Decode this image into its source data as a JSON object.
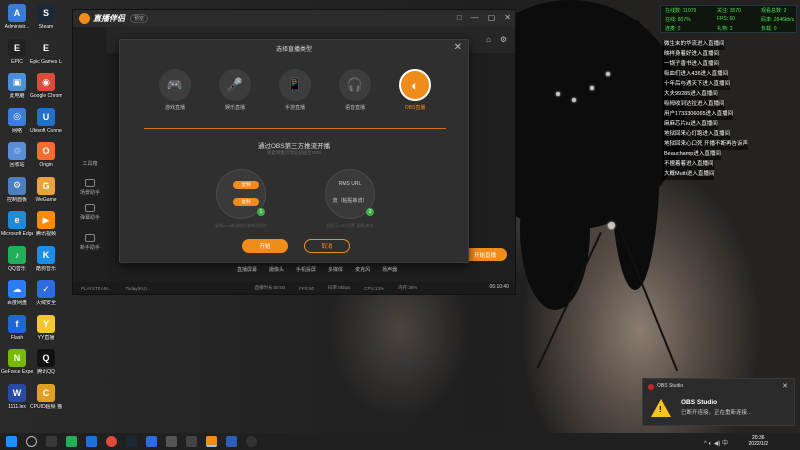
{
  "desktop": {
    "icons": [
      {
        "label": "Administr...",
        "color": "#3a7bd5",
        "glyph": "A"
      },
      {
        "label": "Steam",
        "color": "#1b2838",
        "glyph": "S"
      },
      {
        "label": "EPIC",
        "color": "#222222",
        "glyph": "E"
      },
      {
        "label": "Epic Games Launcher",
        "color": "#2a2a2a",
        "glyph": "E"
      },
      {
        "label": "此电脑",
        "color": "#4a90d9",
        "glyph": "▣"
      },
      {
        "label": "Google Chrome",
        "color": "#dd4b39",
        "glyph": "◉"
      },
      {
        "label": "网络",
        "color": "#3b7dd8",
        "glyph": "◎"
      },
      {
        "label": "Ubisoft Connect",
        "color": "#2470c8",
        "glyph": "U"
      },
      {
        "label": "回收站",
        "color": "#5a8ed8",
        "glyph": "♲"
      },
      {
        "label": "Origin",
        "color": "#f56c2d",
        "glyph": "O"
      },
      {
        "label": "控制面板",
        "color": "#4a7fc1",
        "glyph": "⚙"
      },
      {
        "label": "WeGame",
        "color": "#e8a33d",
        "glyph": "G"
      },
      {
        "label": "Microsoft Edge",
        "color": "#1e8bd8",
        "glyph": "e"
      },
      {
        "label": "腾讯视频",
        "color": "#ff8a00",
        "glyph": "▶"
      },
      {
        "label": "QQ音乐",
        "color": "#20b05a",
        "glyph": "♪"
      },
      {
        "label": "酷狗音乐",
        "color": "#1a8ee8",
        "glyph": "K"
      },
      {
        "label": "百度网盘",
        "color": "#2c7cf6",
        "glyph": "☁"
      },
      {
        "label": "火绒安全",
        "color": "#2d6be0",
        "glyph": "✓"
      },
      {
        "label": "Flash",
        "color": "#1f66d6",
        "glyph": "f"
      },
      {
        "label": "YY直播",
        "color": "#f4c82d",
        "glyph": "Y"
      },
      {
        "label": "GeForce Experience",
        "color": "#76b900",
        "glyph": "N"
      },
      {
        "label": "腾讯QQ",
        "color": "#111111",
        "glyph": "Q"
      },
      {
        "label": "1111.lex",
        "color": "#294aa5",
        "glyph": "W"
      },
      {
        "label": "CPUID超频 猫大师",
        "color": "#e0a020",
        "glyph": "C"
      }
    ]
  },
  "app": {
    "name": "直播伴侣",
    "badge": "预览",
    "win_controls": [
      "□",
      "—",
      "▢",
      "✕"
    ],
    "topbar_icons": [
      "⌂",
      "⚙"
    ],
    "sidebar": [
      {
        "label": "工具箱"
      },
      {
        "label": "场景助手"
      },
      {
        "label": "弹幕助手"
      },
      {
        "label": "新手助手"
      }
    ],
    "live_button": "开始直播",
    "bottom_tools": [
      "直播屏幕",
      "摄像头",
      "手机投屏",
      "多媒体",
      "麦克风",
      "扬声器"
    ],
    "status_items": [
      "PLAYSTEAM...",
      "Today(KU)...",
      "直播时长:00:00",
      "FPS:60",
      "码率:0kbps",
      "CPU:13%",
      "内存:38%"
    ],
    "status_time": "06:10:40"
  },
  "modal": {
    "title": "选择直播类型",
    "close_glyph": "✕",
    "types": [
      {
        "label": "游戏直播",
        "glyph": "🎮",
        "active": false
      },
      {
        "label": "娱乐直播",
        "glyph": "🎤",
        "active": false
      },
      {
        "label": "手游直播",
        "glyph": "📱",
        "active": false
      },
      {
        "label": "语音直播",
        "glyph": "🎧",
        "active": false
      },
      {
        "label": "OBS直播",
        "glyph": "◐",
        "active": true
      }
    ],
    "heading": "通过OBS第三方推流开播",
    "subheading": "请复制推流地址粘贴至OBS",
    "copy_label_1": "复制",
    "copy_label_2": "复制",
    "rtmp_title": "RMS URL",
    "rtmp_hint": "流（粘贴串流）",
    "step_1": "1",
    "step_2": "2",
    "caption_1": "复制rtmp推流地址和串流密钥",
    "caption_2": "粘贴至OBS设置-直播-串流",
    "start_label": "开始",
    "cancel_label": "取消"
  },
  "stats": {
    "row1": [
      "在线数: 11079",
      "关注: 3570",
      "观看总数: 2"
    ],
    "row2": [
      "在线: 807%",
      "FPS: 60",
      "码率: 2846kb/s"
    ],
    "row3": [
      "连麦: 2",
      "礼物: 2",
      "负载: 0"
    ]
  },
  "chat": [
    "微生末的华流进入直播间",
    "映样身着好进入直播间",
    "一锅子香书进入直播间",
    "吸血们进入436进入直播间",
    "十年后与遇天下进入直播间",
    "大夫99285进入直播间",
    "吸拇收到达拉进入直播间",
    "用户1733306065进入直播间",
    "麻麻芯片iu进入直播间",
    "地狱回来心灯跑进入直播间",
    "地狱回来心口死  开播不断再告诉声",
    "Beauchamp进入直播间",
    "不擅着着进入直播间",
    "大概Mutti进入直播间"
  ],
  "toast": {
    "app": "OBS Studio",
    "title": "OBS Studio",
    "message": "已断开连接，正在重新连接...",
    "close_glyph": "✕"
  },
  "taskbar": {
    "time": "20:36",
    "date": "2022/1/2",
    "tray": "^ ◐ ◀) 中"
  }
}
